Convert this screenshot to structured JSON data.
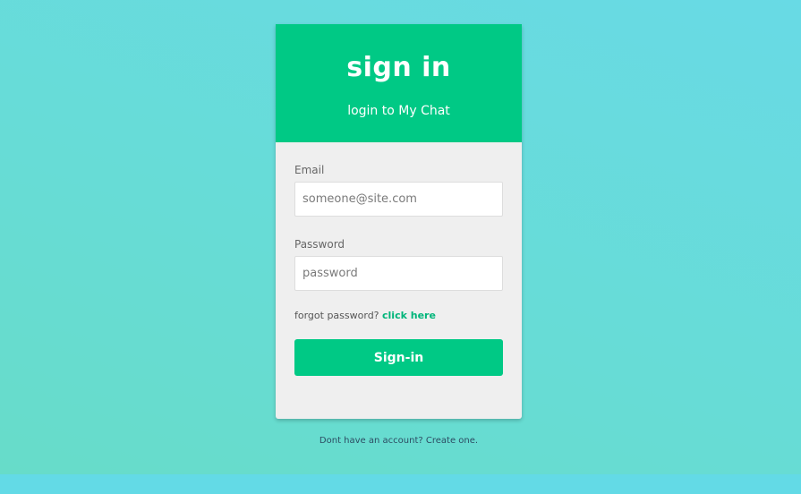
{
  "header": {
    "title": "sign in",
    "subtitle": "login to My Chat"
  },
  "form": {
    "email_label": "Email",
    "email_placeholder": "someone@site.com",
    "password_label": "Password",
    "password_placeholder": "password",
    "forgot_text": "forgot password?",
    "forgot_link": "click here",
    "submit_label": "Sign-in"
  },
  "footer": {
    "signup_text": "Dont have an account? Create one."
  },
  "colors": {
    "accent": "#00c985",
    "background": "#67dcd6",
    "card_body": "#efefef"
  }
}
